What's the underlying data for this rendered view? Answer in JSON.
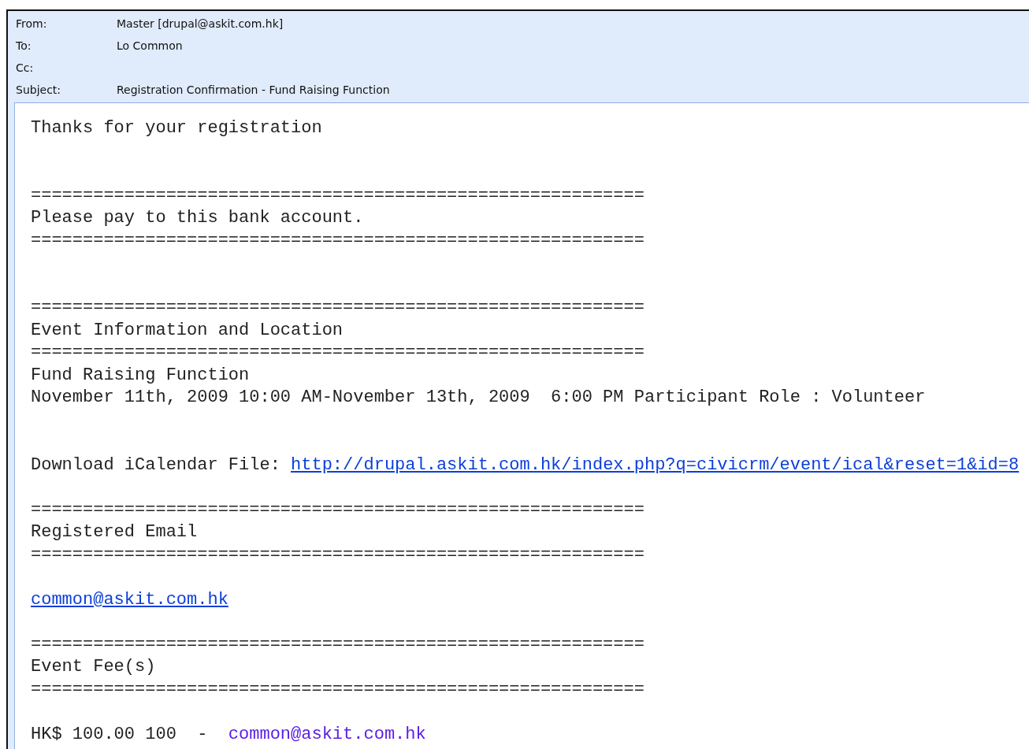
{
  "header": {
    "fields": [
      {
        "label": "From:",
        "value": "Master [drupal@askit.com.hk]"
      },
      {
        "label": "To:",
        "value": "Lo Common"
      },
      {
        "label": "Cc:"
      },
      {
        "label": "Subject:",
        "value": "Registration Confirmation - Fund Raising Function"
      }
    ]
  },
  "body": {
    "lines": [
      {
        "kind": "text",
        "text": "Thanks for your registration"
      },
      {
        "kind": "blank"
      },
      {
        "kind": "blank"
      },
      {
        "kind": "separator",
        "text": "==========================================================="
      },
      {
        "kind": "text",
        "text": "Please pay to this bank account."
      },
      {
        "kind": "separator",
        "text": "==========================================================="
      },
      {
        "kind": "blank"
      },
      {
        "kind": "blank"
      },
      {
        "kind": "separator",
        "text": "==========================================================="
      },
      {
        "kind": "text",
        "text": "Event Information and Location"
      },
      {
        "kind": "separator",
        "text": "==========================================================="
      },
      {
        "kind": "text",
        "text": "Fund Raising Function"
      },
      {
        "kind": "text",
        "text": "November 11th, 2009 10:00 AM-November 13th, 2009  6:00 PM Participant Role : Volunteer"
      },
      {
        "kind": "blank"
      },
      {
        "kind": "blank"
      },
      {
        "kind": "prefixed_link",
        "text": "Download iCalendar File: ",
        "link": "http://drupal.askit.com.hk/index.php?q=civicrm/event/ical&reset=1&id=8"
      },
      {
        "kind": "blank"
      },
      {
        "kind": "separator",
        "text": "==========================================================="
      },
      {
        "kind": "text",
        "text": "Registered Email"
      },
      {
        "kind": "separator",
        "text": "==========================================================="
      },
      {
        "kind": "blank"
      },
      {
        "kind": "link",
        "link": "common@askit.com.hk"
      },
      {
        "kind": "blank"
      },
      {
        "kind": "separator",
        "text": "==========================================================="
      },
      {
        "kind": "text",
        "text": "Event Fee(s)"
      },
      {
        "kind": "separator",
        "text": "==========================================================="
      },
      {
        "kind": "blank"
      },
      {
        "kind": "fee",
        "text": "HK$ 100.00 100  -  ",
        "link": "common@askit.com.hk"
      }
    ]
  }
}
